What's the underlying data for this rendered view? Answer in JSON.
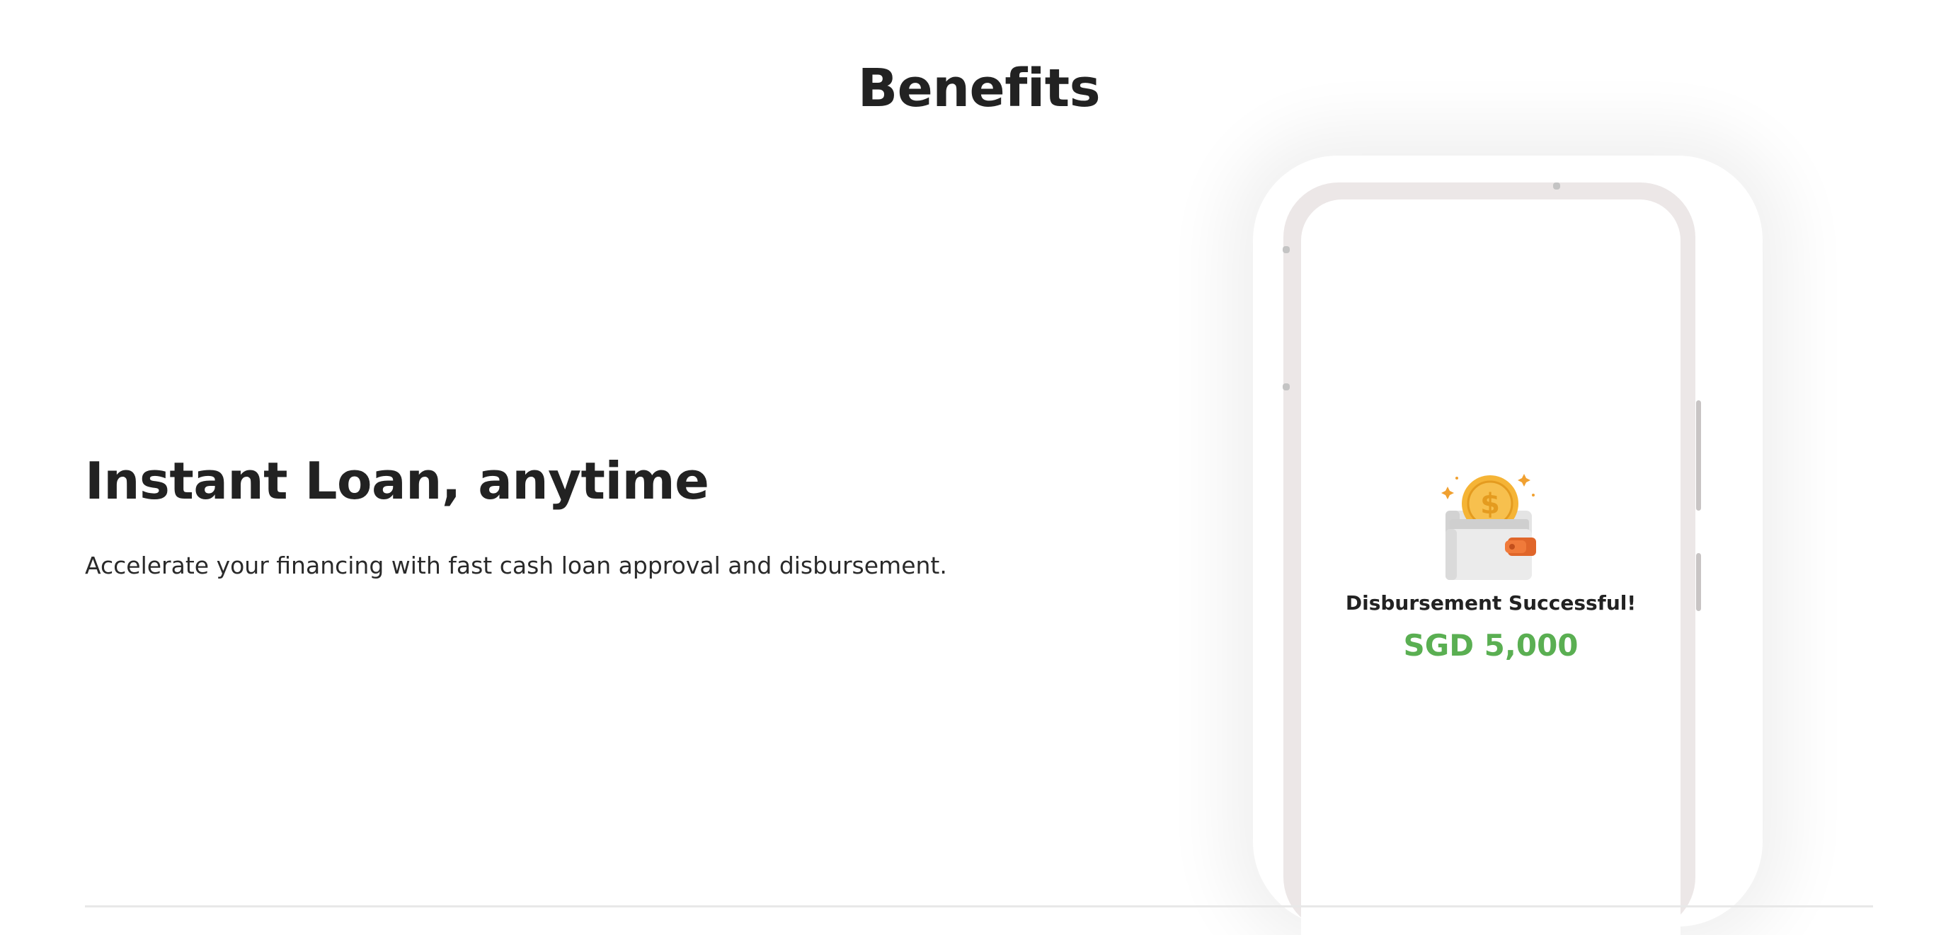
{
  "section": {
    "title": "Benefits"
  },
  "benefit": {
    "heading": "Instant Loan, anytime",
    "description": "Accelerate your financing with fast cash loan approval and disbursement."
  },
  "phone_screen": {
    "status_text": "Disbursement Successful!",
    "amount": "SGD 5,000",
    "icon": "wallet-coin-icon",
    "coin_symbol": "$"
  },
  "colors": {
    "amount_green": "#5aaf52",
    "coin_gold": "#f5b436",
    "wallet_clasp": "#e0662a",
    "phone_frame": "#ece7e7"
  }
}
